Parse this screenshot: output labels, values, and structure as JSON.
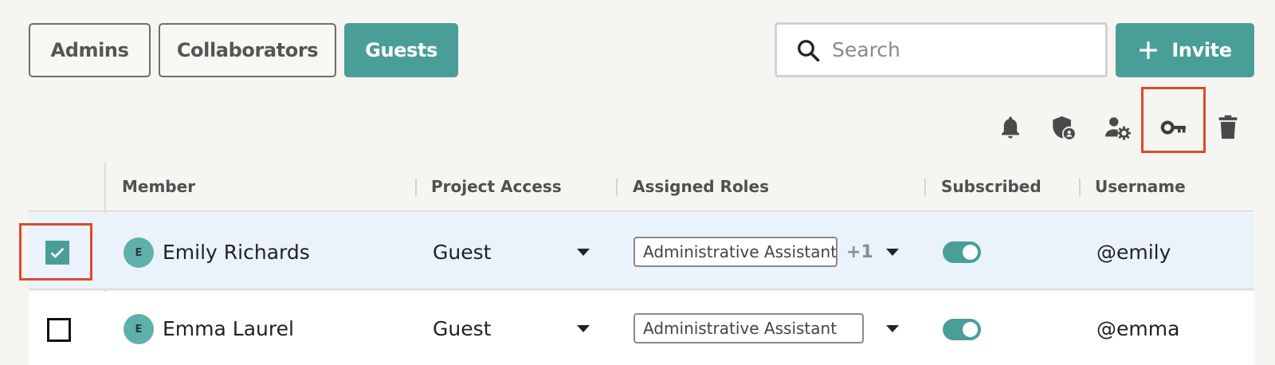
{
  "tabs": [
    {
      "label": "Admins",
      "active": false
    },
    {
      "label": "Collaborators",
      "active": false
    },
    {
      "label": "Guests",
      "active": true
    }
  ],
  "search": {
    "placeholder": "Search",
    "icon": "search-icon"
  },
  "invite": {
    "label": "Invite",
    "icon": "plus-icon"
  },
  "toolbar": {
    "icons": [
      "bell-icon",
      "shield-user-icon",
      "user-settings-icon",
      "key-icon",
      "trash-icon"
    ],
    "highlighted": "key-icon"
  },
  "table": {
    "columns": [
      "Member",
      "Project Access",
      "Assigned Roles",
      "Subscribed",
      "Username"
    ],
    "rows": [
      {
        "selected": true,
        "initial": "E",
        "name": "Emily Richards",
        "access": "Guest",
        "role": "Administrative Assistant",
        "extra_roles": "+1",
        "subscribed": true,
        "username": "@emily"
      },
      {
        "selected": false,
        "initial": "E",
        "name": "Emma Laurel",
        "access": "Guest",
        "role": "Administrative Assistant",
        "extra_roles": "",
        "subscribed": true,
        "username": "@emma"
      }
    ]
  },
  "colors": {
    "accent": "#4a9e98",
    "highlight": "#dd4a2c",
    "selected_row": "#eaf2fc",
    "background": "#f6f5f1"
  }
}
